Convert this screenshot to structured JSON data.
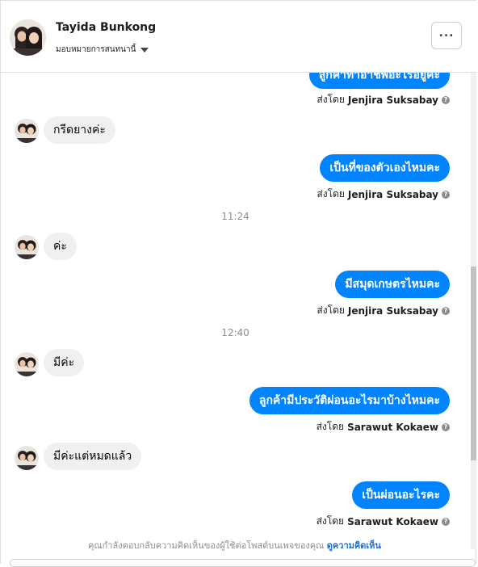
{
  "header": {
    "contact_name": "Tayida Bunkong",
    "assign_label": "มอบหมายการสนทนานี้",
    "more_label": "..."
  },
  "messages": [
    {
      "type": "out",
      "text": "ลูกค้าทำอาชีพอะไรอยู่คะ",
      "sender_prefix": "ส่งโดย",
      "sender": "Jenjira Suksabay"
    },
    {
      "type": "in",
      "text": "กรีดยางค่ะ"
    },
    {
      "type": "out",
      "text": "เป็นที่ของตัวเองไหมคะ",
      "sender_prefix": "ส่งโดย",
      "sender": "Jenjira Suksabay"
    },
    {
      "type": "time",
      "text": "11:24"
    },
    {
      "type": "in",
      "text": "ค่ะ"
    },
    {
      "type": "out",
      "text": "มีสมุดเกษตรไหมคะ",
      "sender_prefix": "ส่งโดย",
      "sender": "Jenjira Suksabay"
    },
    {
      "type": "time",
      "text": "12:40"
    },
    {
      "type": "in",
      "text": "มีค่ะ"
    },
    {
      "type": "out",
      "text": "ลูกค้ามีประวัติผ่อนอะไรมาบ้างไหมคะ",
      "sender_prefix": "ส่งโดย",
      "sender": "Sarawut Kokaew"
    },
    {
      "type": "in",
      "text": "มีค่ะแต่หมดแล้ว"
    },
    {
      "type": "out",
      "text": "เป็นผ่อนอะไรคะ",
      "sender_prefix": "ส่งโดย",
      "sender": "Sarawut Kokaew"
    }
  ],
  "footer": {
    "note": "คุณกำลังตอบกลับความคิดเห็นของผู้ใช้ต่อโพสต์บนเพจของคุณ",
    "link": "ดูความคิดเห็น"
  },
  "colors": {
    "outgoing_bubble": "#0084ff",
    "incoming_bubble": "#f0f0f0",
    "link": "#216fdb"
  }
}
